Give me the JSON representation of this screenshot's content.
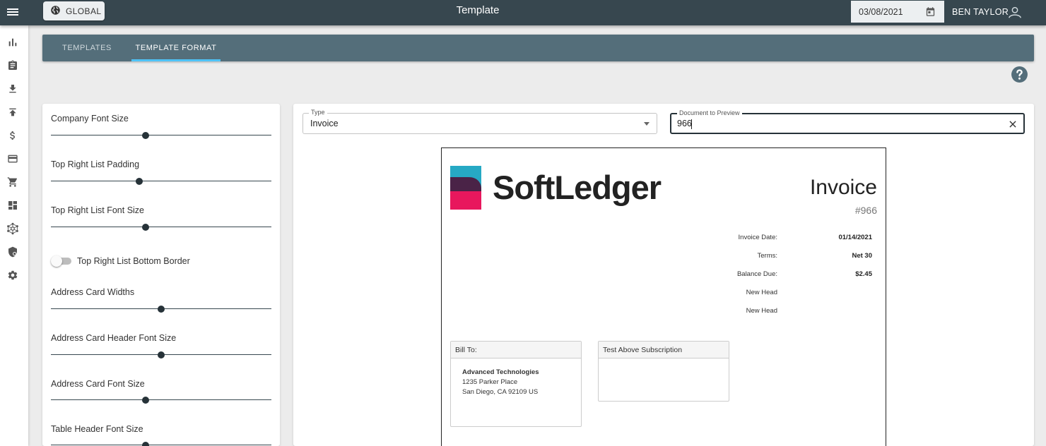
{
  "header": {
    "title": "Template",
    "global_label": "GLOBAL",
    "date": "03/08/2021",
    "user_name": "BEN TAYLOR"
  },
  "sidebar": {
    "icons": [
      "bar-chart-icon",
      "clipboard-icon",
      "download-icon",
      "upload-icon",
      "dollar-icon",
      "credit-card-icon",
      "cart-icon",
      "dashboard-icon",
      "network-icon",
      "shield-icon",
      "gear-icon"
    ]
  },
  "tabs": [
    {
      "label": "TEMPLATES",
      "active": false
    },
    {
      "label": "TEMPLATE FORMAT",
      "active": true
    }
  ],
  "settings": {
    "sliders": [
      {
        "label": "Company Font Size",
        "value": 0.43
      },
      {
        "label": "Top Right List Padding",
        "value": 0.4
      },
      {
        "label": "Top Right List Font Size",
        "value": 0.43
      },
      {
        "label": "Address Card Widths",
        "value": 0.5
      },
      {
        "label": "Address Card Header Font Size",
        "value": 0.5
      },
      {
        "label": "Address Card Font Size",
        "value": 0.43
      },
      {
        "label": "Table Header Font Size",
        "value": 0.43
      }
    ],
    "toggle": {
      "label": "Top Right List Bottom Border",
      "on": false
    }
  },
  "preview": {
    "type_field": {
      "legend": "Type",
      "value": "Invoice"
    },
    "document_field": {
      "legend": "Document to Preview",
      "value": "966"
    }
  },
  "invoice": {
    "logo_text": "SoftLedger",
    "title": "Invoice",
    "number": "#966",
    "meta": [
      {
        "label": "Invoice Date:",
        "value": "01/14/2021"
      },
      {
        "label": "Terms:",
        "value": "Net 30"
      },
      {
        "label": "Balance Due:",
        "value": "$2.45"
      },
      {
        "label": "New Head",
        "value": ""
      },
      {
        "label": "New Head",
        "value": ""
      }
    ],
    "bill_to": {
      "header": "Bill To:",
      "company": "Advanced Technologies",
      "address1": "1235 Parker Place",
      "address2": "San Diego, CA 92109 US"
    },
    "subscription_card": {
      "header": "Test Above Subscription"
    }
  },
  "colors": {
    "topbar": "#37474f",
    "tabs": "#546e7a",
    "tab_indicator": "#4fc3f7",
    "logo_teal": "#26a9c4",
    "logo_purple": "#4a2347",
    "logo_pink": "#e8175d"
  }
}
